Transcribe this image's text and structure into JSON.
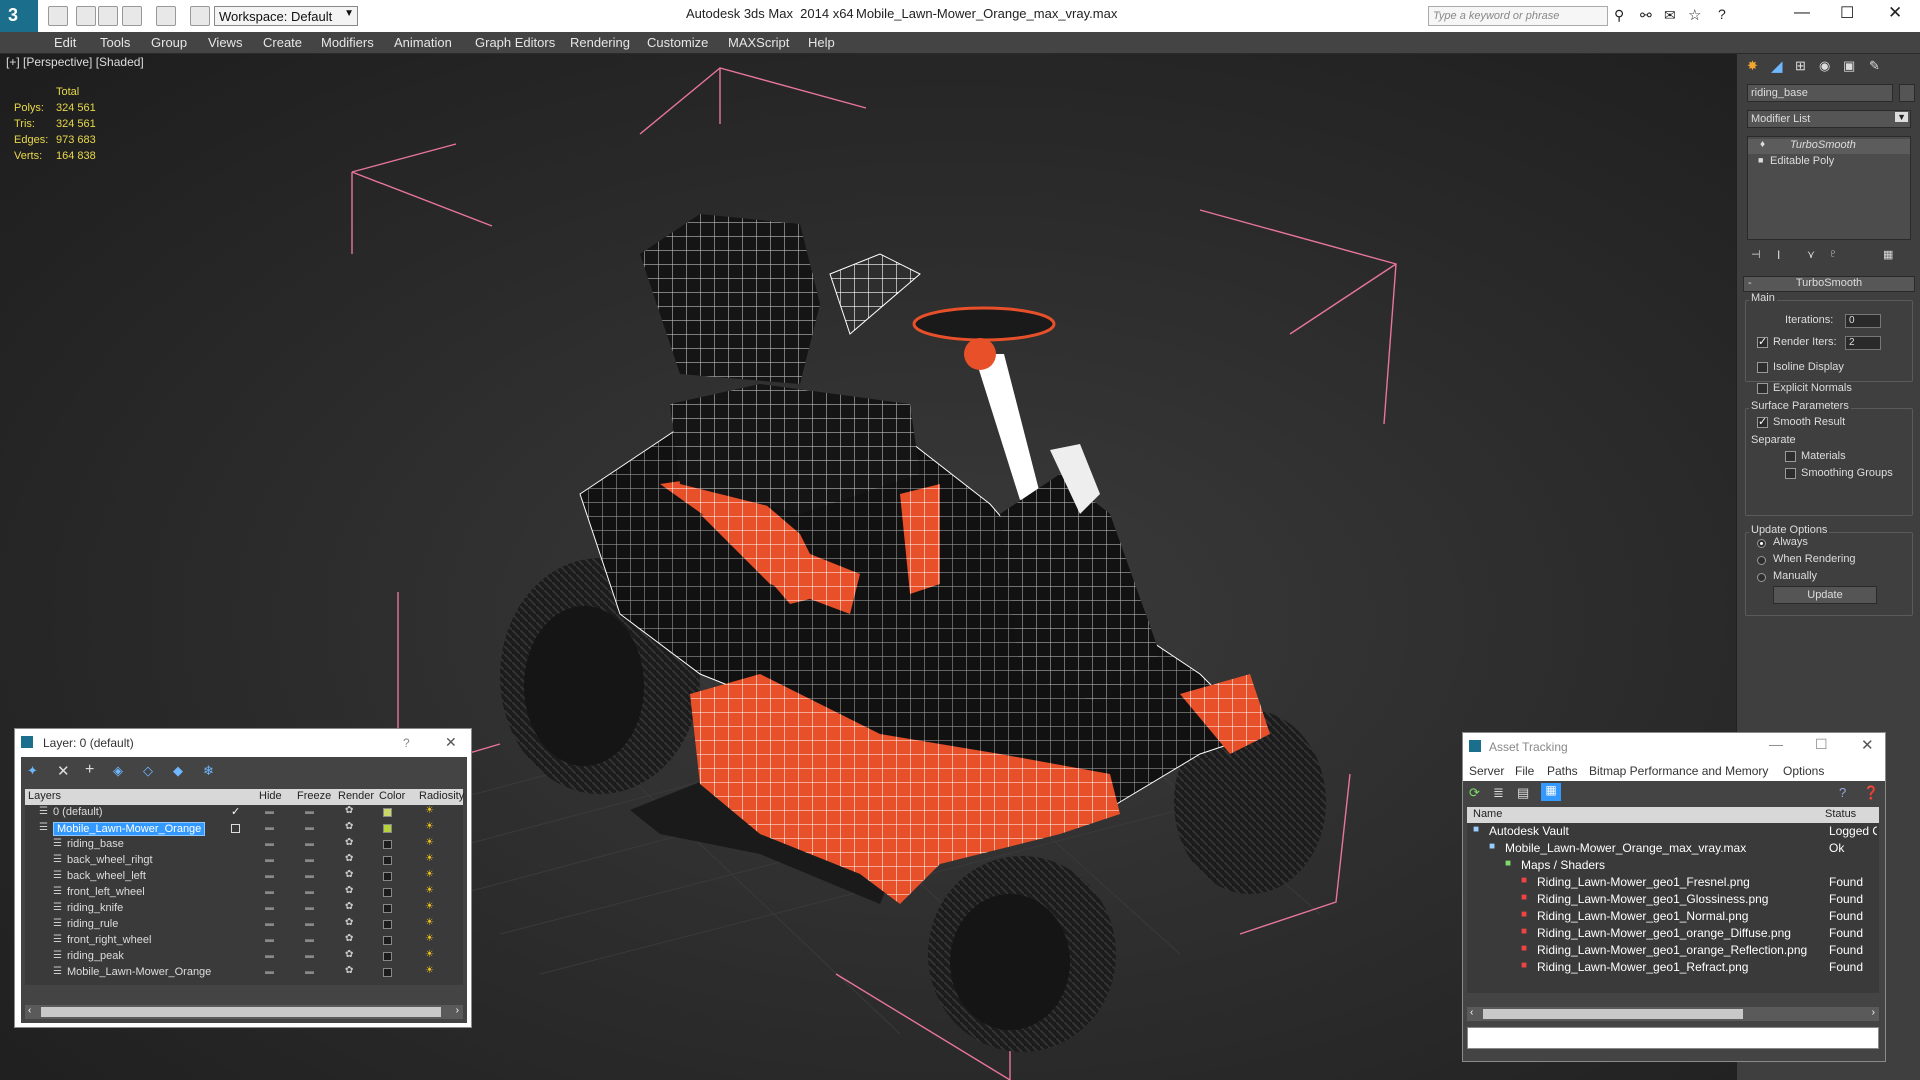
{
  "window": {
    "app_title": "Autodesk 3ds Max  2014 x64",
    "file_title": "Mobile_Lawn-Mower_Orange_max_vray.max",
    "workspace": "Workspace: Default",
    "search_placeholder": "Type a keyword or phrase"
  },
  "menu": [
    "Edit",
    "Tools",
    "Group",
    "Views",
    "Create",
    "Modifiers",
    "Animation",
    "Graph Editors",
    "Rendering",
    "Customize",
    "MAXScript",
    "Help"
  ],
  "viewport": {
    "label": "[+] [Perspective] [Shaded]",
    "stats_header": "Total",
    "stats": [
      {
        "label": "Polys:",
        "value": "324 561"
      },
      {
        "label": "Tris:",
        "value": "324 561"
      },
      {
        "label": "Edges:",
        "value": "973 683"
      },
      {
        "label": "Verts:",
        "value": "164 838"
      }
    ]
  },
  "command_panel": {
    "object_name": "riding_base",
    "modifier_list": "Modifier List",
    "stack": [
      "TurboSmooth",
      "Editable Poly"
    ],
    "rollout_title": "TurboSmooth",
    "main_group": "Main",
    "iterations_label": "Iterations:",
    "iterations_value": "0",
    "render_iters_label": "Render Iters:",
    "render_iters_value": "2",
    "isoline": "Isoline Display",
    "explicit_normals": "Explicit Normals",
    "surface_group": "Surface Parameters",
    "smooth_result": "Smooth Result",
    "separate": "Separate",
    "materials": "Materials",
    "smoothing_groups": "Smoothing Groups",
    "update_group": "Update Options",
    "always": "Always",
    "when_rendering": "When Rendering",
    "manually": "Manually",
    "update_button": "Update"
  },
  "layer_dialog": {
    "title": "Layer: 0 (default)",
    "help": "?",
    "close": "✕",
    "columns": [
      "Layers",
      "Hide",
      "Freeze",
      "Render",
      "Color",
      "Radiosity"
    ],
    "rows": [
      {
        "name": "0 (default)",
        "level": 0,
        "color": "#c8d86a"
      },
      {
        "name": "Mobile_Lawn-Mower_Orange",
        "level": 0,
        "selected": true,
        "color": "#b6d23a"
      },
      {
        "name": "riding_base",
        "level": 1,
        "color": "#1c1c1c"
      },
      {
        "name": "back_wheel_rihgt",
        "level": 1,
        "color": "#1c1c1c"
      },
      {
        "name": "back_wheel_left",
        "level": 1,
        "color": "#1c1c1c"
      },
      {
        "name": "front_left_wheel",
        "level": 1,
        "color": "#1c1c1c"
      },
      {
        "name": "riding_knife",
        "level": 1,
        "color": "#1c1c1c"
      },
      {
        "name": "riding_rule",
        "level": 1,
        "color": "#1c1c1c"
      },
      {
        "name": "front_right_wheel",
        "level": 1,
        "color": "#1c1c1c"
      },
      {
        "name": "riding_peak",
        "level": 1,
        "color": "#1c1c1c"
      },
      {
        "name": "Mobile_Lawn-Mower_Orange",
        "level": 1,
        "color": "#1c1c1c"
      }
    ]
  },
  "asset_dialog": {
    "title": "Asset Tracking",
    "menus": [
      "Server",
      "File",
      "Paths",
      "Bitmap Performance and Memory",
      "Options"
    ],
    "columns": [
      "Name",
      "Status"
    ],
    "rows": [
      {
        "name": "Autodesk Vault",
        "status": "Logged Ou",
        "level": 0
      },
      {
        "name": "Mobile_Lawn-Mower_Orange_max_vray.max",
        "status": "Ok",
        "level": 1
      },
      {
        "name": "Maps / Shaders",
        "status": "",
        "level": 2
      },
      {
        "name": "Riding_Lawn-Mower_geo1_Fresnel.png",
        "status": "Found",
        "level": 3
      },
      {
        "name": "Riding_Lawn-Mower_geo1_Glossiness.png",
        "status": "Found",
        "level": 3
      },
      {
        "name": "Riding_Lawn-Mower_geo1_Normal.png",
        "status": "Found",
        "level": 3
      },
      {
        "name": "Riding_Lawn-Mower_geo1_orange_Diffuse.png",
        "status": "Found",
        "level": 3
      },
      {
        "name": "Riding_Lawn-Mower_geo1_orange_Reflection.png",
        "status": "Found",
        "level": 3
      },
      {
        "name": "Riding_Lawn-Mower_geo1_Refract.png",
        "status": "Found",
        "level": 3
      }
    ]
  },
  "colors": {
    "accent": "#1a8cd8",
    "orange": "#e8502a",
    "selection": "#3399ff",
    "stats": "#e8d84a"
  }
}
